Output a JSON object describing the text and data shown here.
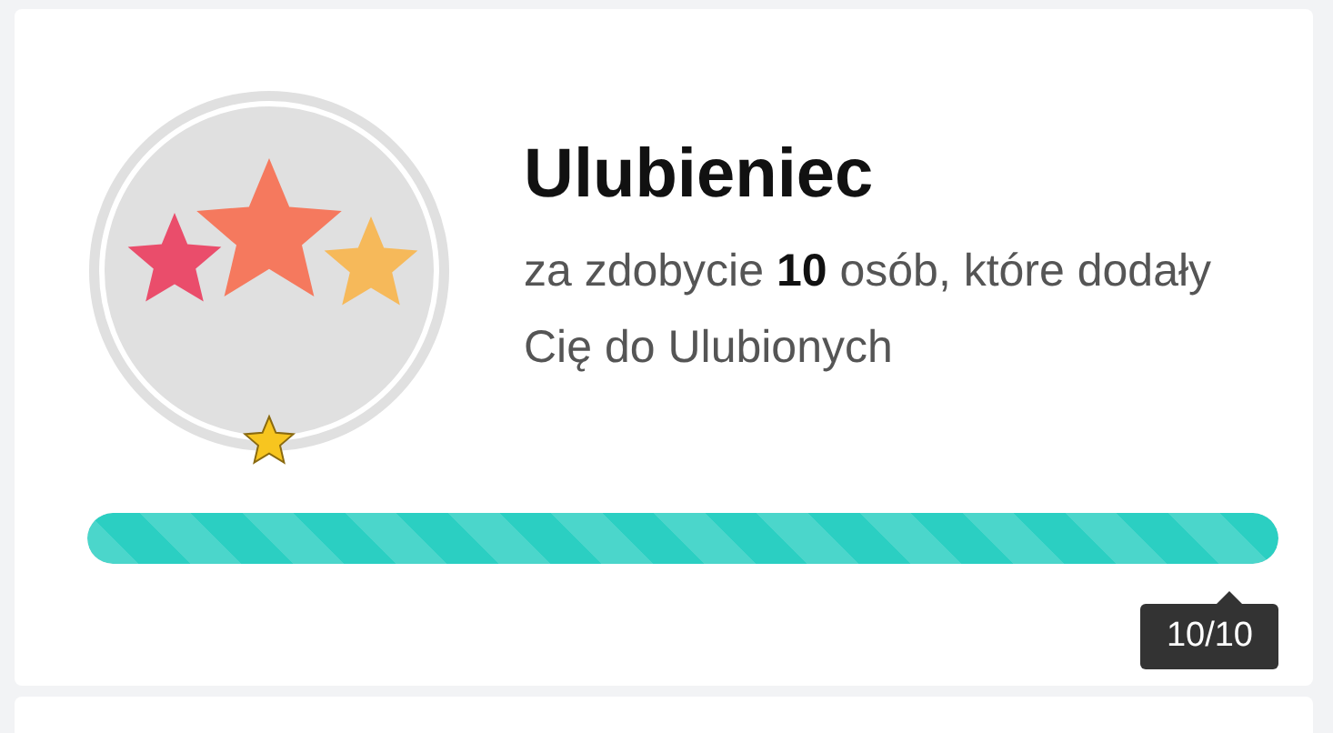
{
  "achievement": {
    "title": "Ulubieniec",
    "description": "za zdobycie **10** osób, które dodały Cię do Ulubionych"
  },
  "progress": {
    "level": 1,
    "reading": "10/10"
  }
}
